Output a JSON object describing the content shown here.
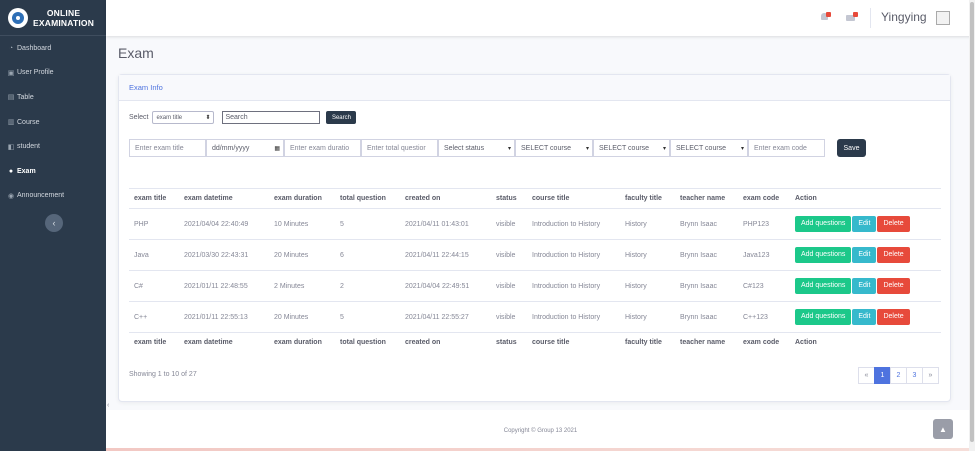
{
  "brand": {
    "line1": "ONLINE",
    "line2": "EXAMINATION"
  },
  "sidebar": {
    "items": [
      {
        "label": "Dashboard",
        "icon": "dashboard-icon"
      },
      {
        "label": "User Profile",
        "icon": "user-profile-icon"
      },
      {
        "label": "Table",
        "icon": "table-icon"
      },
      {
        "label": "Course",
        "icon": "course-icon"
      },
      {
        "label": "student",
        "icon": "student-icon"
      },
      {
        "label": "Exam",
        "icon": "user-icon",
        "active": true
      },
      {
        "label": "Announcement",
        "icon": "announcement-icon"
      }
    ],
    "toggle": "‹"
  },
  "topbar": {
    "username": "Yingying"
  },
  "page": {
    "title": "Exam"
  },
  "card": {
    "header": "Exam Info"
  },
  "filter": {
    "label": "Select",
    "select_value": "exam title",
    "search_placeholder": "Search",
    "search_button": "Search"
  },
  "form": {
    "exam_title_placeholder": "Enter exam title",
    "date_placeholder": "dd/mm/yyyy",
    "duration_placeholder": "Enter exam duratio",
    "total_question_placeholder": "Enter total questior",
    "status_select": "Select status",
    "course_select_1": "SELECT course",
    "course_select_2": "SELECT course",
    "course_select_3": "SELECT course",
    "exam_code_placeholder": "Enter exam code",
    "save_button": "Save"
  },
  "table": {
    "headers": [
      "exam title",
      "exam datetime",
      "exam duration",
      "total question",
      "created on",
      "status",
      "course title",
      "faculty title",
      "teacher name",
      "exam code",
      "Action"
    ],
    "rows": [
      [
        "PHP",
        "2021/04/04 22:40:49",
        "10 Minutes",
        "5",
        "2021/04/11 01:43:01",
        "visible",
        "Introduction to History",
        "History",
        "Brynn Isaac",
        "PHP123"
      ],
      [
        "Java",
        "2021/03/30 22:43:31",
        "20 Minutes",
        "6",
        "2021/04/11 22:44:15",
        "visible",
        "Introduction to History",
        "History",
        "Brynn Isaac",
        "Java123"
      ],
      [
        "C#",
        "2021/01/11 22:48:55",
        "2 Minutes",
        "2",
        "2021/04/04 22:49:51",
        "visible",
        "Introduction to History",
        "History",
        "Brynn Isaac",
        "C#123"
      ],
      [
        "C++",
        "2021/01/11 22:55:13",
        "20 Minutes",
        "5",
        "2021/04/11 22:55:27",
        "visible",
        "Introduction to History",
        "History",
        "Brynn Isaac",
        "C++123"
      ]
    ],
    "actions": {
      "add": "Add questions",
      "edit": "Edit",
      "delete": "Delete"
    }
  },
  "showing": "Showing 1 to 10 of 27",
  "pagination": {
    "prev": "«",
    "pages": [
      "1",
      "2",
      "3"
    ],
    "next": "»",
    "current": "1"
  },
  "footer": {
    "copyright": "Copyright © Group 13 2021"
  },
  "scroll_top": "▲",
  "colors": {
    "sidebar": "#2b3a4b",
    "primary": "#4e73df",
    "success": "#1cc88a",
    "info": "#36b9cc",
    "danger": "#e74a3b"
  }
}
